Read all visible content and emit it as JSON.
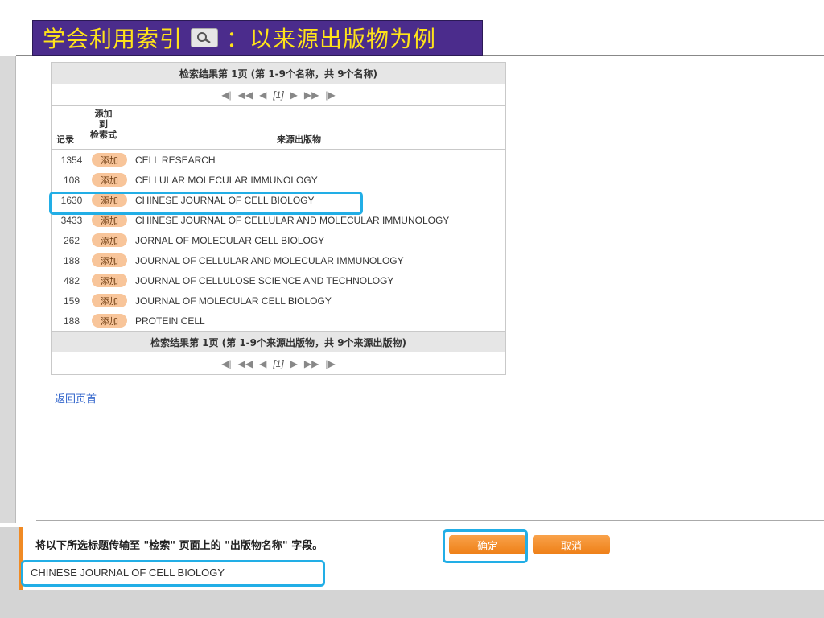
{
  "banner": {
    "title_left": "学会利用索引",
    "title_right": "：以来源出版物为例",
    "icon": "magnifier-icon"
  },
  "results": {
    "header_top": "检索结果第 1页 (第 1-9个名称，共 9个名称)",
    "pager": {
      "first": "⏮",
      "prev2": "◀◀",
      "prev": "◀",
      "page": "[1]",
      "next": "▶",
      "next2": "▶▶",
      "last": "⏭"
    },
    "columns": {
      "record": "记录",
      "add_line1": "添加",
      "add_line2": "到",
      "add_line3": "检索式",
      "source": "来源出版物"
    },
    "add_label": "添加",
    "rows": [
      {
        "record": "1354",
        "source": "CELL RESEARCH"
      },
      {
        "record": "108",
        "source": "CELLULAR MOLECULAR IMMUNOLOGY"
      },
      {
        "record": "1630",
        "source": "CHINESE JOURNAL OF CELL BIOLOGY"
      },
      {
        "record": "3433",
        "source": "CHINESE JOURNAL OF CELLULAR AND MOLECULAR IMMUNOLOGY"
      },
      {
        "record": "262",
        "source": "JORNAL OF MOLECULAR CELL BIOLOGY"
      },
      {
        "record": "188",
        "source": "JOURNAL OF CELLULAR AND MOLECULAR IMMUNOLOGY"
      },
      {
        "record": "482",
        "source": "JOURNAL OF CELLULOSE SCIENCE AND TECHNOLOGY"
      },
      {
        "record": "159",
        "source": "JOURNAL OF MOLECULAR CELL BIOLOGY"
      },
      {
        "record": "188",
        "source": "PROTEIN CELL"
      }
    ],
    "header_bottom": "检索结果第 1页 (第 1-9个来源出版物，共 9个来源出版物)"
  },
  "back_link": "返回页首",
  "transfer": {
    "label": "将以下所选标题传输至 \"检索\" 页面上的 \"出版物名称\" 字段。",
    "ok": "确定",
    "cancel": "取消",
    "value": "CHINESE JOURNAL OF CELL BIOLOGY"
  },
  "colors": {
    "banner_bg": "#4b2c8c",
    "banner_text": "#ffe31a",
    "highlight": "#22aee6",
    "orange": "#f08a24"
  }
}
